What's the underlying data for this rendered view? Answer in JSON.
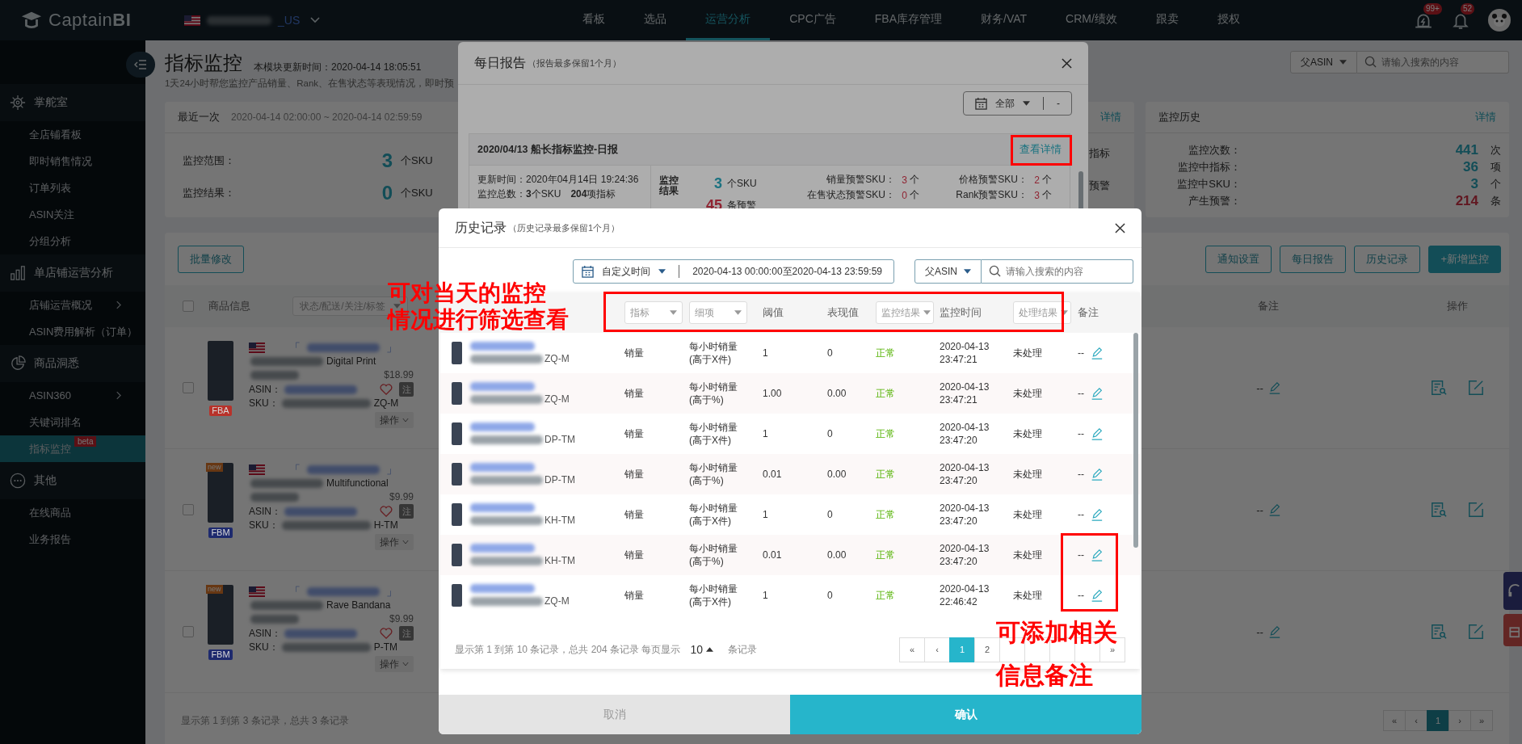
{
  "top_nav": {
    "logo": "Captain**BI**",
    "store_suffix": "_US",
    "items": [
      {
        "label": "看板",
        "selected": false
      },
      {
        "label": "选品",
        "selected": false
      },
      {
        "label": "运营分析",
        "selected": true
      },
      {
        "label": "CPC广告",
        "selected": false
      },
      {
        "label": "FBA库存管理",
        "selected": false
      },
      {
        "label": "财务/VAT",
        "selected": false
      },
      {
        "label": "CRM/绩效",
        "selected": false
      },
      {
        "label": "跟卖",
        "selected": false
      },
      {
        "label": "授权",
        "selected": false
      }
    ],
    "alert_badge": "99+",
    "notification_badge": "52"
  },
  "sidebar": {
    "groups": [
      {
        "kind": "helm",
        "title": "掌舵室",
        "items": [
          {
            "label": "全店铺看板",
            "selected": false,
            "has_submenu": false
          },
          {
            "label": "即时销售情况",
            "selected": false,
            "has_submenu": false
          },
          {
            "label": "订单列表",
            "selected": false,
            "has_submenu": false
          },
          {
            "label": "ASIN关注",
            "selected": false,
            "has_submenu": false
          },
          {
            "label": "分组分析",
            "selected": false,
            "has_submenu": false
          }
        ]
      },
      {
        "kind": "bars",
        "title": "单店铺运营分析",
        "items": [
          {
            "label": "店铺运营概况",
            "selected": false,
            "has_submenu": true
          },
          {
            "label": "ASIN费用解析（订单）",
            "selected": false,
            "has_submenu": false
          }
        ]
      },
      {
        "kind": "pie",
        "title": "商品洞悉",
        "items": [
          {
            "label": "ASIN360",
            "selected": false,
            "has_submenu": true
          },
          {
            "label": "关键词排名",
            "selected": false,
            "has_submenu": false
          },
          {
            "label": "指标监控",
            "selected": true,
            "has_submenu": false,
            "badge": "beta"
          }
        ]
      },
      {
        "kind": "more",
        "title": "其他",
        "items": [
          {
            "label": "在线商品",
            "selected": false,
            "has_submenu": false
          },
          {
            "label": "业务报告",
            "selected": false,
            "has_submenu": false
          }
        ]
      }
    ]
  },
  "page_header": {
    "title": "指标监控",
    "update_time": "本模块更新时间：2020-04-14 18:05:51",
    "description": "1天24小时帮您监控产品销量、Rank、在售状态等表现情况，即时预",
    "search_scope": "父ASIN",
    "search_placeholder": "请输入搜索的内容"
  },
  "latest_card": {
    "title": "最近一次",
    "time_range": "2020-04-14 02:00:00 ~ 2020-04-14 02:59:59",
    "rows": [
      {
        "label": "监控范围：",
        "value": "3",
        "unit": "个SKU"
      },
      {
        "label": "监控结果：",
        "value": "0",
        "unit": "个SKU"
      }
    ]
  },
  "middle_card": {
    "link": "详情",
    "labels": [
      "指标",
      "预警"
    ]
  },
  "history_card": {
    "title": "监控历史",
    "link": "详情",
    "rows": [
      {
        "label": "监控次数：",
        "value": "441",
        "unit": "次",
        "kind": "normal"
      },
      {
        "label": "监控中指标：",
        "value": "36",
        "unit": "项",
        "kind": "normal"
      },
      {
        "label": "监控中SKU：",
        "value": "3",
        "unit": "个",
        "kind": "normal"
      },
      {
        "label": "产生预警：",
        "value": "214",
        "unit": "条",
        "kind": "alert"
      }
    ]
  },
  "product_table": {
    "bulk_button": "批量修改",
    "action_buttons": [
      {
        "label": "通知设置",
        "primary": false
      },
      {
        "label": "每日报告",
        "primary": false
      },
      {
        "label": "历史记录",
        "primary": false
      },
      {
        "label": "+新增监控",
        "primary": true
      }
    ],
    "header_checked": false,
    "columns": {
      "product": "商品信息",
      "filter_placeholder": "状态/配送/关注/标签",
      "note": "备注",
      "actions": "操作"
    },
    "rows": [
      {
        "checked": false,
        "fulfillment": {
          "label": "FBA",
          "color": "#b8322a"
        },
        "store_open": "「",
        "store_close": "」",
        "title_visible": "Digital Print",
        "price": "$18.99",
        "asin_label": "ASIN：",
        "sku_label": "SKU：",
        "sku_suffix": "ZQ-M",
        "note_button": "注",
        "menu_button": "操作",
        "note": "--"
      },
      {
        "checked": false,
        "new_tag": "new",
        "fulfillment": {
          "label": "FBM",
          "color": "#1e2a6e"
        },
        "store_open": "「",
        "store_close": "」",
        "title_visible": "Multifunctional",
        "price": "$9.99",
        "asin_label": "ASIN：",
        "sku_label": "SKU：",
        "sku_suffix": "H-TM",
        "note_button": "注",
        "menu_button": "操作",
        "note": "--"
      },
      {
        "checked": false,
        "new_tag": "new",
        "fulfillment": {
          "label": "FBM",
          "color": "#1e2a6e"
        },
        "store_open": "「",
        "store_close": "」",
        "title_visible": "Rave Bandana",
        "price": "$9.99",
        "asin_label": "ASIN：",
        "sku_label": "SKU：",
        "sku_suffix": "P-TM",
        "note_button": "注",
        "menu_button": "操作",
        "note": "--"
      }
    ],
    "footer": "显示第 1 到第 3 条记录，总共 3 条记录",
    "pagination": [
      {
        "label": "«",
        "selected": false
      },
      {
        "label": "‹",
        "selected": false
      },
      {
        "label": "1",
        "selected": true
      },
      {
        "label": "›",
        "selected": false
      },
      {
        "label": "»",
        "selected": false
      }
    ]
  },
  "daily_report_modal": {
    "title": "每日报告",
    "subtitle": "（报告最多保留1个月）",
    "date_filter": "全部",
    "date_value": "-",
    "report": {
      "title": "2020/04/13 船长指标监控-日报",
      "link": "查看详情",
      "update_time": "更新时间：2020年04月14日 19:24:36",
      "total": "监控总数：**3**个SKU　**204**项指标",
      "result_label": "监控结果",
      "sku_count": "3",
      "sku_unit": "个SKU",
      "alert_count": "45",
      "alert_unit": "条预警",
      "warnings": [
        {
          "label": "销量预警SKU：",
          "value": "3",
          "unit": "个"
        },
        {
          "label": "价格预警SKU：",
          "value": "2",
          "unit": "个"
        },
        {
          "label": "在售状态预警SKU：",
          "value": "0",
          "unit": "个"
        },
        {
          "label": "Rank预警SKU：",
          "value": "3",
          "unit": "个"
        }
      ]
    }
  },
  "history_modal": {
    "title": "历史记录",
    "subtitle": "（历史记录最多保留1个月）",
    "date_mode": "自定义时间",
    "date_range": "2020-04-13 00:00:00至2020-04-13 23:59:59",
    "search_scope": "父ASIN",
    "search_placeholder": "请输入搜索的内容",
    "columns": [
      {
        "label": "指标",
        "kind": "select"
      },
      {
        "label": "细项",
        "kind": "select"
      },
      {
        "label": "阈值",
        "kind": "text"
      },
      {
        "label": "表现值",
        "kind": "text"
      },
      {
        "label": "监控结果",
        "kind": "select"
      },
      {
        "label": "监控时间",
        "kind": "text"
      },
      {
        "label": "处理结果",
        "kind": "select"
      },
      {
        "label": "备注",
        "kind": "text"
      }
    ],
    "rows": [
      {
        "sku_suffix": "ZQ-M",
        "indicator": "销量",
        "detail": "每小时销量\n(高于X件)",
        "threshold": "1",
        "actual": "0",
        "result": "正常",
        "time": "2020-04-13 23:47:21",
        "status": "未处理",
        "note": "--"
      },
      {
        "sku_suffix": "ZQ-M",
        "indicator": "销量",
        "detail": "每小时销量\n(高于%)",
        "threshold": "1.00",
        "actual": "0.00",
        "result": "正常",
        "time": "2020-04-13 23:47:21",
        "status": "未处理",
        "note": "--"
      },
      {
        "sku_suffix": "DP-TM",
        "indicator": "销量",
        "detail": "每小时销量\n(高于X件)",
        "threshold": "1",
        "actual": "0",
        "result": "正常",
        "time": "2020-04-13 23:47:20",
        "status": "未处理",
        "note": "--"
      },
      {
        "sku_suffix": "DP-TM",
        "indicator": "销量",
        "detail": "每小时销量\n(高于%)",
        "threshold": "0.01",
        "actual": "0.00",
        "result": "正常",
        "time": "2020-04-13 23:47:20",
        "status": "未处理",
        "note": "--"
      },
      {
        "sku_suffix": "KH-TM",
        "indicator": "销量",
        "detail": "每小时销量\n(高于X件)",
        "threshold": "1",
        "actual": "0",
        "result": "正常",
        "time": "2020-04-13 23:47:20",
        "status": "未处理",
        "note": "--"
      },
      {
        "sku_suffix": "KH-TM",
        "indicator": "销量",
        "detail": "每小时销量\n(高于%)",
        "threshold": "0.01",
        "actual": "0.00",
        "result": "正常",
        "time": "2020-04-13 23:47:20",
        "status": "未处理",
        "note": "--"
      },
      {
        "sku_suffix": "ZQ-M",
        "indicator": "销量",
        "detail": "每小时销量\n(高于X件)",
        "threshold": "1",
        "actual": "0",
        "result": "正常",
        "time": "2020-04-13 22:46:42",
        "status": "未处理",
        "note": "--"
      }
    ],
    "footer_text": "显示第 1 到第 10 条记录，总共 204 条记录 每页显示",
    "page_size": "10",
    "footer_unit": "条记录",
    "pagination": [
      {
        "label": "«",
        "selected": false
      },
      {
        "label": "‹",
        "selected": false
      },
      {
        "label": "1",
        "selected": true
      },
      {
        "label": "2",
        "selected": false
      },
      {
        "selected": false
      },
      {
        "selected": false
      },
      {
        "selected": false
      },
      {
        "selected": false
      },
      {
        "label": "»",
        "selected": false
      }
    ],
    "cancel": "取消",
    "confirm": "确认"
  },
  "annotations": [
    {
      "lines": [
        "可对当天的监控",
        "情况进行筛选查看"
      ]
    },
    {
      "lines": [
        "可添加相关",
        "信息备注"
      ]
    }
  ]
}
